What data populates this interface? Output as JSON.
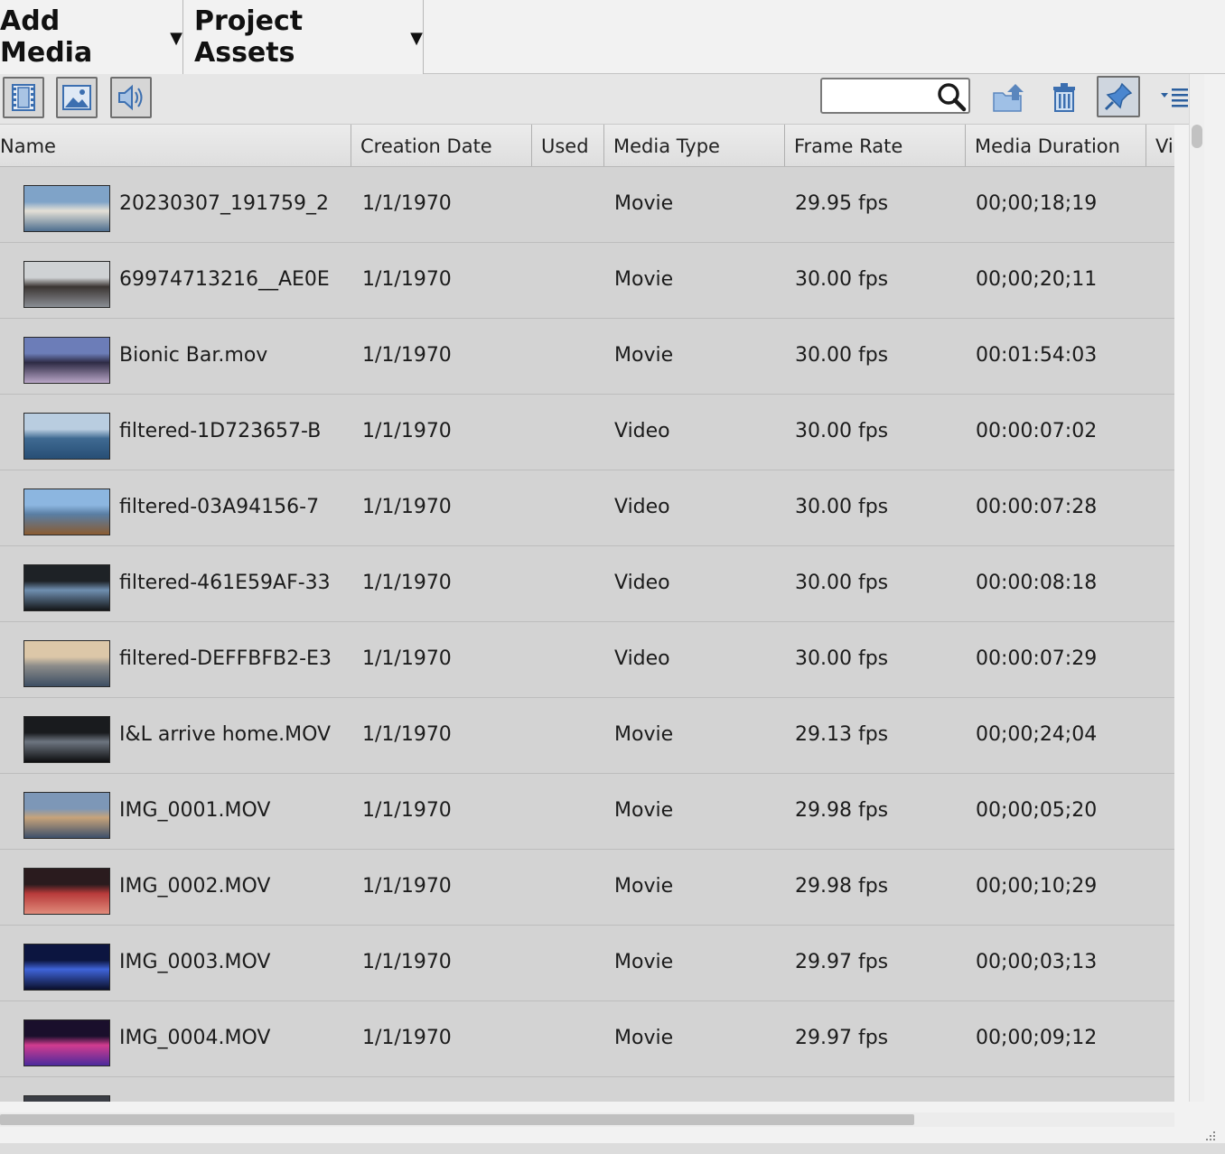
{
  "tabs": {
    "add_media": "Add Media",
    "project_assets": "Project Assets"
  },
  "toolbar": {
    "search_placeholder": "",
    "icons": [
      "film-icon",
      "image-icon",
      "audio-icon",
      "search-icon",
      "export-icon",
      "trash-icon",
      "pin-icon",
      "view-options-icon"
    ]
  },
  "columns": {
    "name": "Name",
    "creation_date": "Creation Date",
    "used": "Used",
    "media_type": "Media Type",
    "frame_rate": "Frame Rate",
    "media_duration": "Media Duration",
    "video": "Vi"
  },
  "rows": [
    {
      "name": "20230307_191759_2",
      "date": "1/1/1970",
      "type": "Movie",
      "rate": "29.95 fps",
      "duration": "00;00;18;19",
      "thumb": [
        "#7fa3c8",
        "#e4e0d6",
        "#4e6f8f"
      ]
    },
    {
      "name": "69974713216__AE0E",
      "date": "1/1/1970",
      "type": "Movie",
      "rate": "30.00 fps",
      "duration": "00;00;20;11",
      "thumb": [
        "#cfd2d4",
        "#3b3532",
        "#8a8e94"
      ]
    },
    {
      "name": "Bionic Bar.mov",
      "date": "1/1/1970",
      "type": "Movie",
      "rate": "30.00 fps",
      "duration": "00:01:54:03",
      "thumb": [
        "#6c7db8",
        "#2d2a44",
        "#b9a6c7"
      ]
    },
    {
      "name": "filtered-1D723657-B",
      "date": "1/1/1970",
      "type": "Video",
      "rate": "30.00 fps",
      "duration": "00:00:07:02",
      "thumb": [
        "#b9cde0",
        "#3f6a92",
        "#274e75"
      ]
    },
    {
      "name": "filtered-03A94156-7",
      "date": "1/1/1970",
      "type": "Video",
      "rate": "30.00 fps",
      "duration": "00:00:07:28",
      "thumb": [
        "#8cb6e0",
        "#5a7ea3",
        "#8a5c32"
      ]
    },
    {
      "name": "filtered-461E59AF-33",
      "date": "1/1/1970",
      "type": "Video",
      "rate": "30.00 fps",
      "duration": "00:00:08:18",
      "thumb": [
        "#1e2226",
        "#6f8fb0",
        "#141618"
      ]
    },
    {
      "name": "filtered-DEFFBFB2-E3",
      "date": "1/1/1970",
      "type": "Video",
      "rate": "30.00 fps",
      "duration": "00:00:07:29",
      "thumb": [
        "#dcc7a8",
        "#8c8c8a",
        "#3d4e63"
      ]
    },
    {
      "name": "I&L arrive home.MOV",
      "date": "1/1/1970",
      "type": "Movie",
      "rate": "29.13 fps",
      "duration": "00;00;24;04",
      "thumb": [
        "#191b1e",
        "#6d7580",
        "#0d0e10"
      ]
    },
    {
      "name": "IMG_0001.MOV",
      "date": "1/1/1970",
      "type": "Movie",
      "rate": "29.98 fps",
      "duration": "00;00;05;20",
      "thumb": [
        "#7d97b7",
        "#c7a37a",
        "#3c4f6a"
      ]
    },
    {
      "name": "IMG_0002.MOV",
      "date": "1/1/1970",
      "type": "Movie",
      "rate": "29.98 fps",
      "duration": "00;00;10;29",
      "thumb": [
        "#2a1b1e",
        "#b83a3a",
        "#e08b7b"
      ]
    },
    {
      "name": "IMG_0003.MOV",
      "date": "1/1/1970",
      "type": "Movie",
      "rate": "29.97 fps",
      "duration": "00;00;03;13",
      "thumb": [
        "#0c1540",
        "#3f64d9",
        "#0a0f2a"
      ]
    },
    {
      "name": "IMG_0004.MOV",
      "date": "1/1/1970",
      "type": "Movie",
      "rate": "29.97 fps",
      "duration": "00;00;09;12",
      "thumb": [
        "#1a0f2c",
        "#d23c8f",
        "#4b2a9c"
      ]
    },
    {
      "name": "",
      "date": "",
      "type": "",
      "rate": "",
      "duration": "",
      "thumb": [
        "#3a3d44",
        "#8a7a5e",
        "#222428"
      ]
    }
  ]
}
